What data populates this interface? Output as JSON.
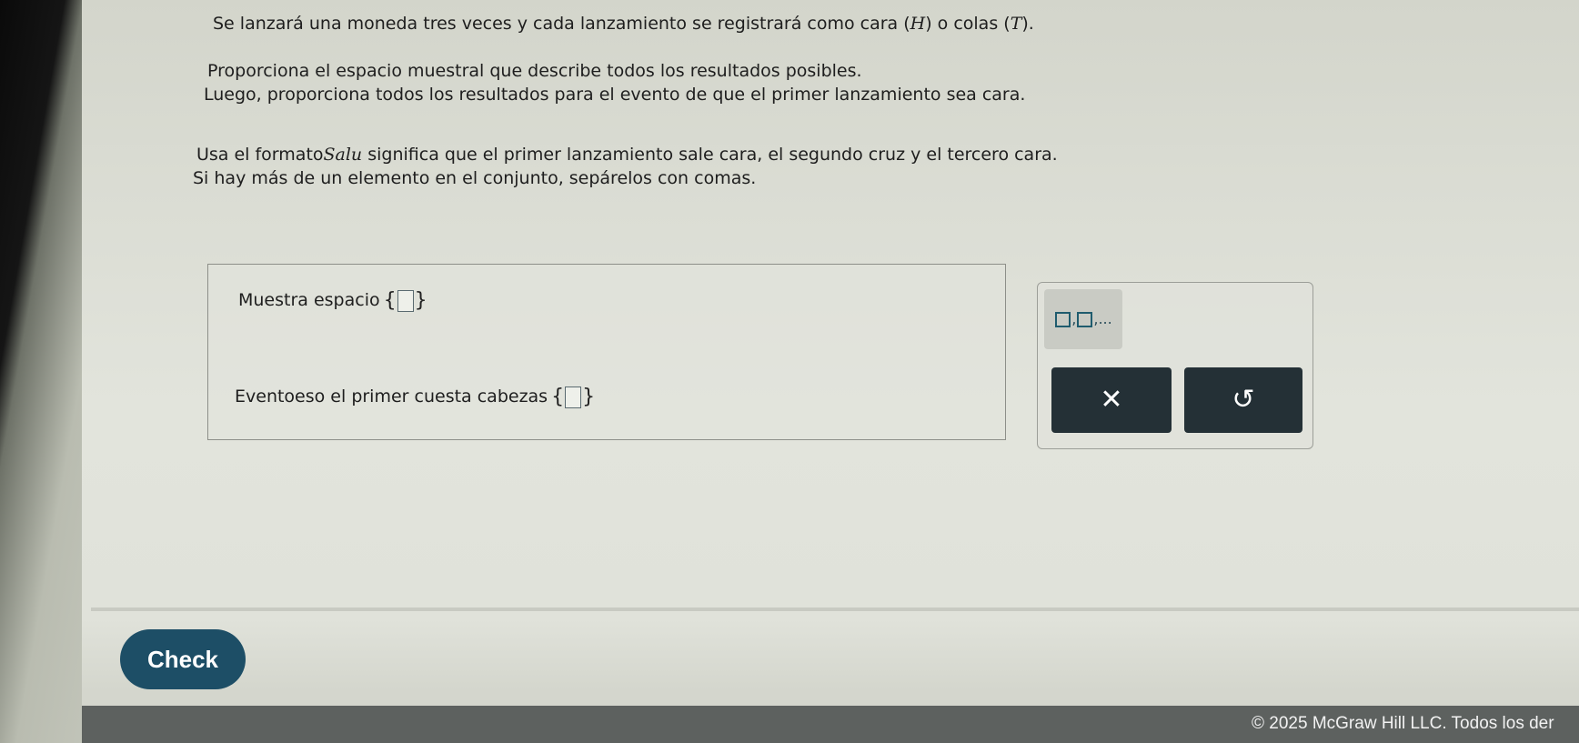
{
  "question": {
    "line1_a": "Se lanzará una moneda tres veces y cada lanzamiento se registrará como cara (",
    "line1_h": "H",
    "line1_b": ") o colas (",
    "line1_t": "T",
    "line1_c": ").",
    "line2": "Proporciona el espacio muestral que describe todos los resultados posibles.",
    "line3": "Luego, proporciona todos los resultados para el evento de que el primer lanzamiento sea cara.",
    "line4_a": "Usa el formato",
    "line4_var": "Salu",
    "line4_b": "significa que el primer lanzamiento sale cara, el segundo cruz y el tercero cara.",
    "line5": "Si hay más de un elemento en el conjunto, sepárelos con comas."
  },
  "answer": {
    "sample_space_label": "Muestra espacio",
    "event_label": "Eventoeso el primer cuesta cabezas"
  },
  "tools": {
    "set_button_label": "□,□,...",
    "clear_symbol": "✕",
    "undo_symbol": "↺"
  },
  "check_label": "Check",
  "footer": {
    "copyright": "© 2025 McGraw Hill LLC. Todos los der"
  }
}
